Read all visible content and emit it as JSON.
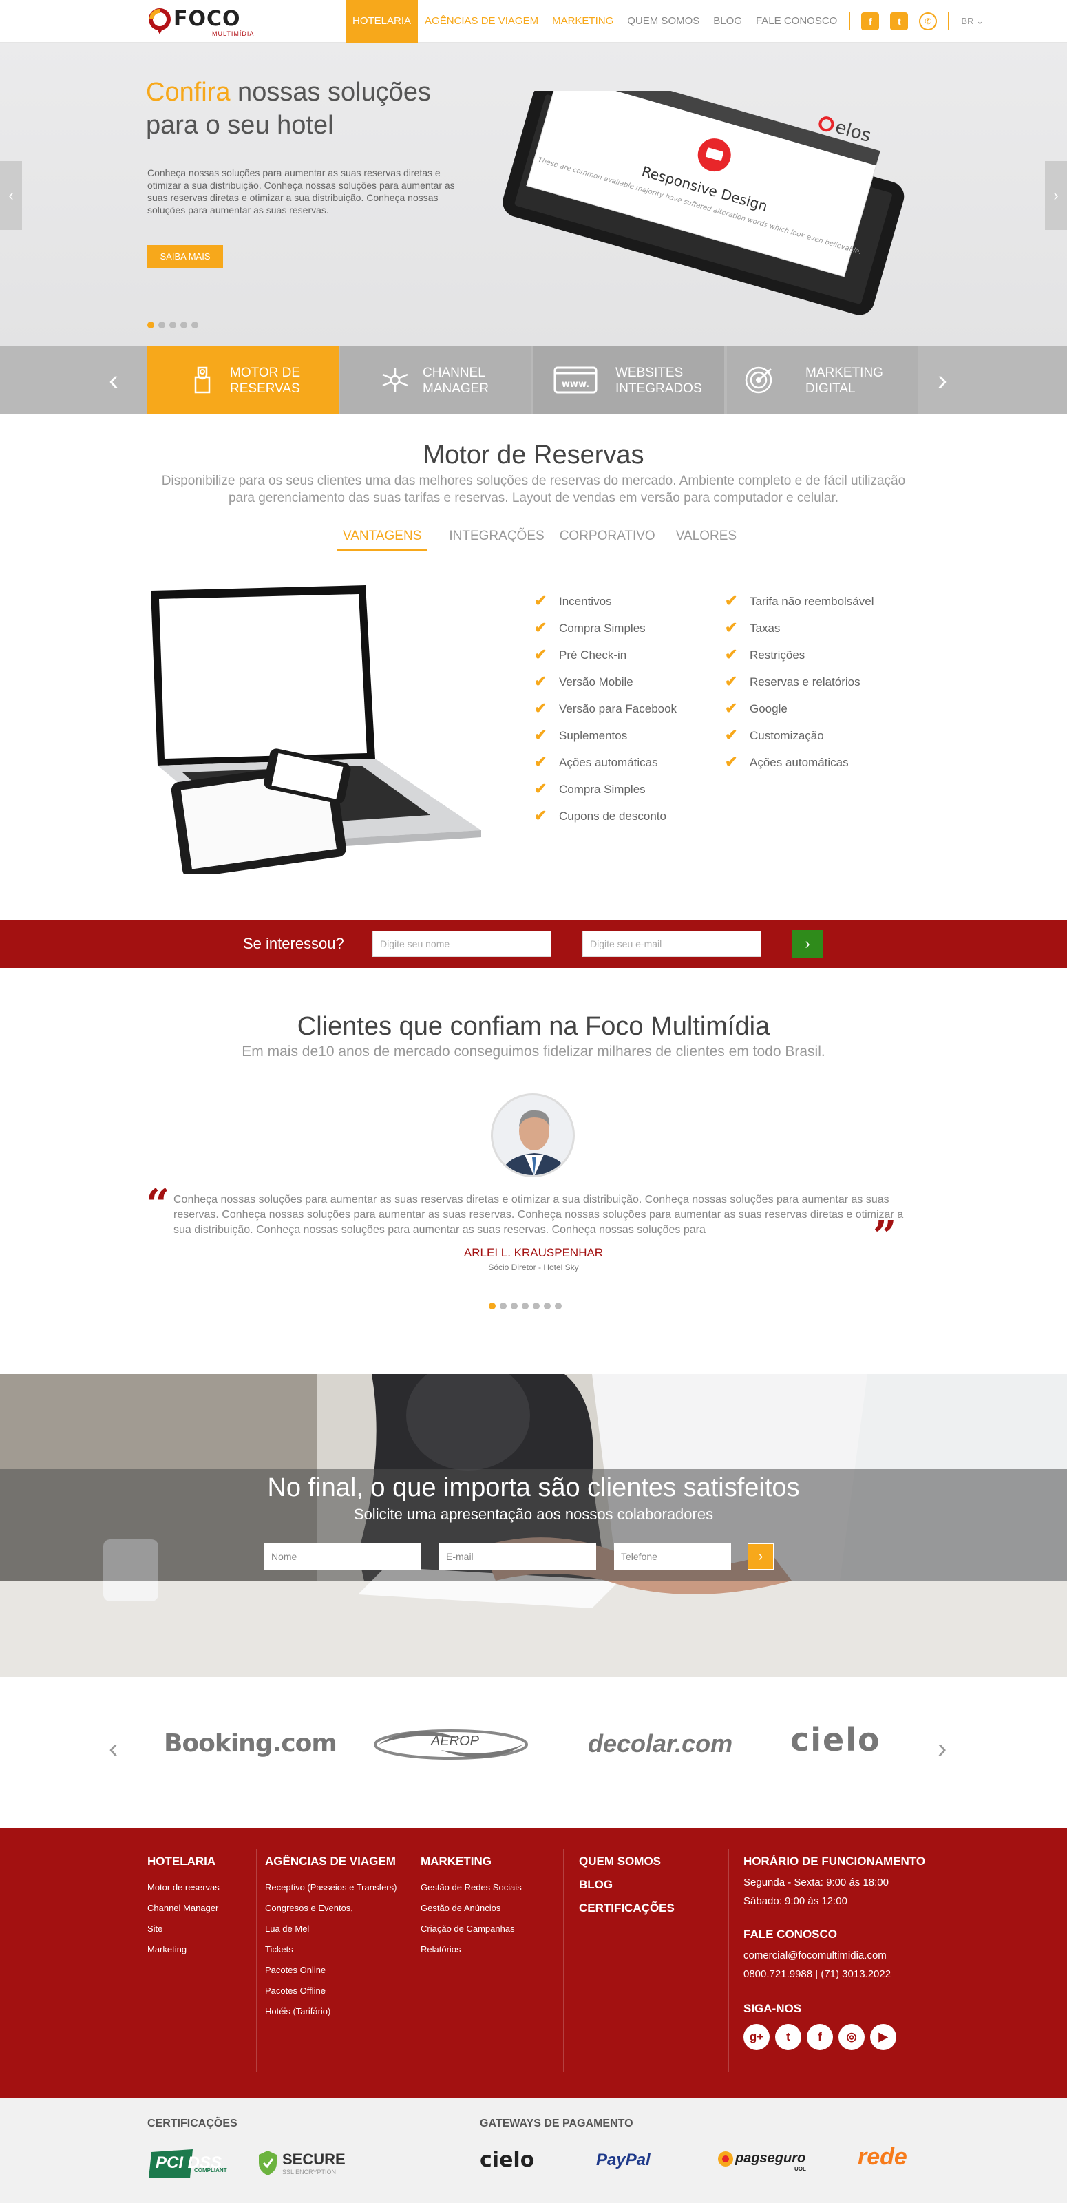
{
  "header": {
    "logo_text": "FOCO",
    "logo_sub": "MULTIMÍDIA",
    "nav": [
      {
        "label": "HOTELARIA"
      },
      {
        "label": "AGÊNCIAS DE VIAGEM"
      },
      {
        "label": "MARKETING"
      },
      {
        "label": "QUEM SOMOS"
      },
      {
        "label": "BLOG"
      },
      {
        "label": "FALE CONOSCO"
      }
    ],
    "lang": "BR"
  },
  "hero": {
    "title_highlight": "Confira",
    "title_rest": " nossas soluções",
    "title_line2": "para o seu hotel",
    "text": "Conheça nossas soluções para aumentar as suas reservas diretas e otimizar a sua distribuição. Conheça nossas soluções para aumentar as suas reservas diretas e otimizar a sua distribuição. Conheça nossas soluções para aumentar as suas reservas.",
    "button": "SAIBA MAIS",
    "tablet_brand": "elos",
    "tablet_heading": "Responsive Design",
    "tablet_text": "These are common available majority have suffered alteration words which look even believable.",
    "slide_count": 5,
    "active_slide": 0
  },
  "services": [
    {
      "label": "MOTOR DE\nRESERVAS"
    },
    {
      "label": "CHANNEL\nMANAGER"
    },
    {
      "label": "WEBSITES\nINTEGRADOS"
    },
    {
      "label": "MARKETING\nDIGITAL"
    }
  ],
  "motor": {
    "title": "Motor de Reservas",
    "subtitle": "Disponibilize para os seus clientes uma das melhores soluções de reservas do mercado. Ambiente completo e de fácil utilização para gerenciamento das suas tarifas e reservas. Layout de vendas em versão para computador e celular.",
    "tabs": [
      "VANTAGENS",
      "INTEGRAÇÕES",
      "CORPORATIVO",
      "VALORES"
    ],
    "features_left": [
      "Incentivos",
      "Compra Simples",
      "Pré Check-in",
      "Versão Mobile",
      "Versão para Facebook",
      "Suplementos",
      "Ações automáticas",
      "Compra Simples",
      "Cupons de desconto"
    ],
    "features_right": [
      "Tarifa não reembolsável",
      "Taxas",
      "Restrições",
      "Reservas e relatórios",
      "Google",
      "Customização",
      "Ações automáticas"
    ]
  },
  "interest": {
    "label": "Se interessou?",
    "name_placeholder": "Digite seu nome",
    "email_placeholder": "Digite seu e-mail",
    "go": "›"
  },
  "clients": {
    "title": "Clientes que confiam na Foco Multimídia",
    "subtitle": "Em mais de10 anos de mercado conseguimos fidelizar milhares de clientes em todo Brasil.",
    "quote": "Conheça nossas soluções para aumentar as suas reservas diretas e otimizar a sua distribuição. Conheça nossas soluções para aumentar as suas reservas. Conheça nossas soluções para aumentar as suas reservas. Conheça nossas soluções para aumentar as suas reservas diretas e otimizar a sua distribuição. Conheça nossas soluções para aumentar as suas reservas. Conheça nossas soluções para",
    "name": "ARLEI L. KRAUSPENHAR",
    "role": "Sócio Diretor - Hotel Sky",
    "slide_count": 7,
    "active_slide": 0
  },
  "cta": {
    "title": "No final, o que importa são clientes satisfeitos",
    "subtitle": "Solicite uma apresentação aos nossos colaboradores",
    "name_placeholder": "Nome",
    "email_placeholder": "E-mail",
    "phone_placeholder": "Telefone",
    "go": "›"
  },
  "partners": [
    "Booking.com",
    "AEROP",
    "decolar.com",
    "cielo"
  ],
  "footer": {
    "hotelaria": {
      "title": "HOTELARIA",
      "links": [
        "Motor de reservas",
        "Channel Manager",
        "Site",
        "Marketing"
      ]
    },
    "agencias": {
      "title": "AGÊNCIAS DE VIAGEM",
      "links": [
        "Receptivo (Passeios e Transfers)",
        "Congresos e Eventos,",
        "Lua de Mel",
        "Tickets",
        "Pacotes Online",
        "Pacotes Offline",
        "Hotéis (Tarifário)"
      ]
    },
    "marketing": {
      "title": "MARKETING",
      "links": [
        "Gestão de Redes Sociais",
        "Gestão de Anúncios",
        "Criação de Campanhas",
        "Relatórios"
      ]
    },
    "quick": [
      "QUEM SOMOS",
      "BLOG",
      "CERTIFICAÇÕES"
    ],
    "hours_title": "HORÁRIO DE FUNCIONAMENTO",
    "hours": [
      "Segunda - Sexta: 9:00 ás 18:00",
      "Sábado: 9:00 às 12:00"
    ],
    "contact_title": "FALE CONOSCO",
    "contact": [
      "comercial@focomultimidia.com",
      "0800.721.9988 | (71) 3013.2022"
    ],
    "social_title": "SIGA-NOS"
  },
  "bottom": {
    "cert_title": "CERTIFICAÇÕES",
    "gateway_title": "GATEWAYS DE PAGAMENTO",
    "cert_logos": [
      "PCI DSS",
      "SECURE"
    ],
    "cert_pci_sub": "COMPLIANT",
    "cert_secure_sub": "SSL ENCRYPTION",
    "gateways": [
      "cielo",
      "PayPal",
      "pagseguro",
      "rede"
    ],
    "pagseguro_sub": "UOL"
  },
  "colors": {
    "accent": "#f7a81b",
    "brand_red": "#a31111",
    "go_green": "#2f8b1b"
  }
}
